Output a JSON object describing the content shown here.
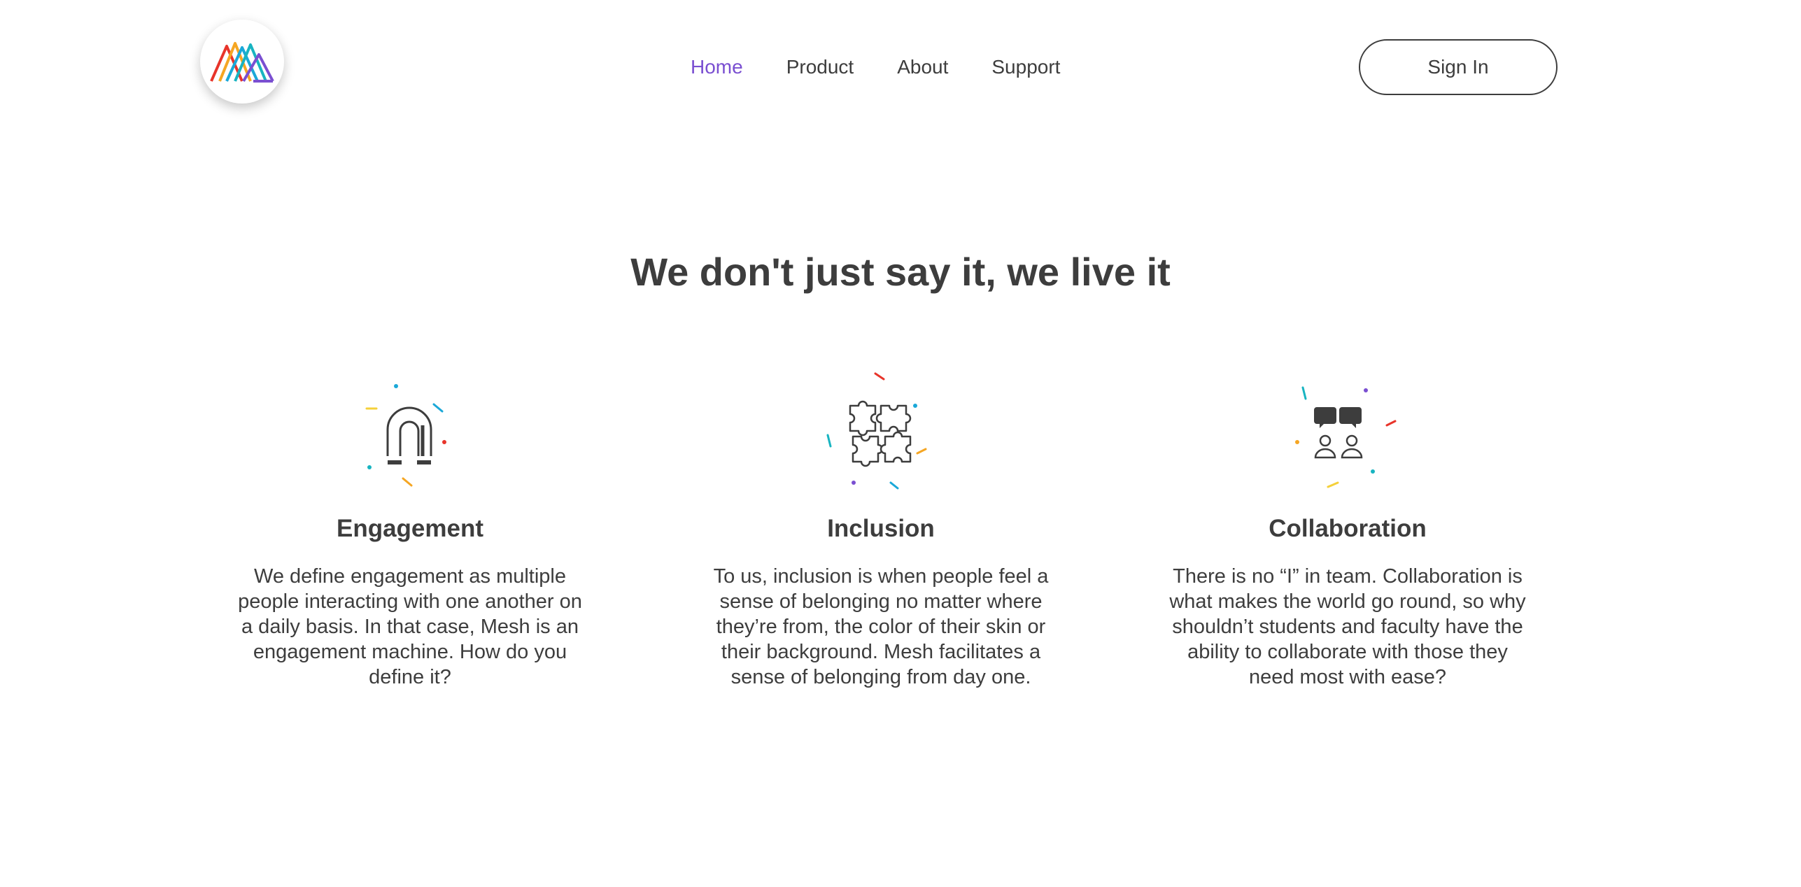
{
  "brand": {
    "logo_icon": "mesh-logo-icon"
  },
  "nav": {
    "items": [
      {
        "label": "Home",
        "active": true
      },
      {
        "label": "Product",
        "active": false
      },
      {
        "label": "About",
        "active": false
      },
      {
        "label": "Support",
        "active": false
      }
    ],
    "active_color": "#7a4fd1"
  },
  "header": {
    "signin_label": "Sign In"
  },
  "main": {
    "headline": "We don't just say it, we live it",
    "features": [
      {
        "icon": "magnet-icon",
        "title": "Engagement",
        "text": "We define engagement as multiple people interacting with one another on a daily basis. In that case, Mesh is an engagement machine. How do you define it?"
      },
      {
        "icon": "puzzle-icon",
        "title": "Inclusion",
        "text": "To us, inclusion is when people feel a sense of belonging no matter where they’re from, the color of their skin or their background. Mesh facilitates a sense of belonging from day one."
      },
      {
        "icon": "collaboration-icon",
        "title": "Collaboration",
        "text": "There is no “I” in team. Collaboration is what makes the world go round, so why shouldn’t students and faculty have the ability to collaborate with those they need most with ease?"
      }
    ]
  },
  "colors": {
    "text": "#3d3d3d",
    "accent_purple": "#7a4fd1",
    "confetti": [
      "#e8342a",
      "#f5a623",
      "#f5d03a",
      "#1aa8d8",
      "#18b4c1",
      "#7a4fd1"
    ]
  }
}
